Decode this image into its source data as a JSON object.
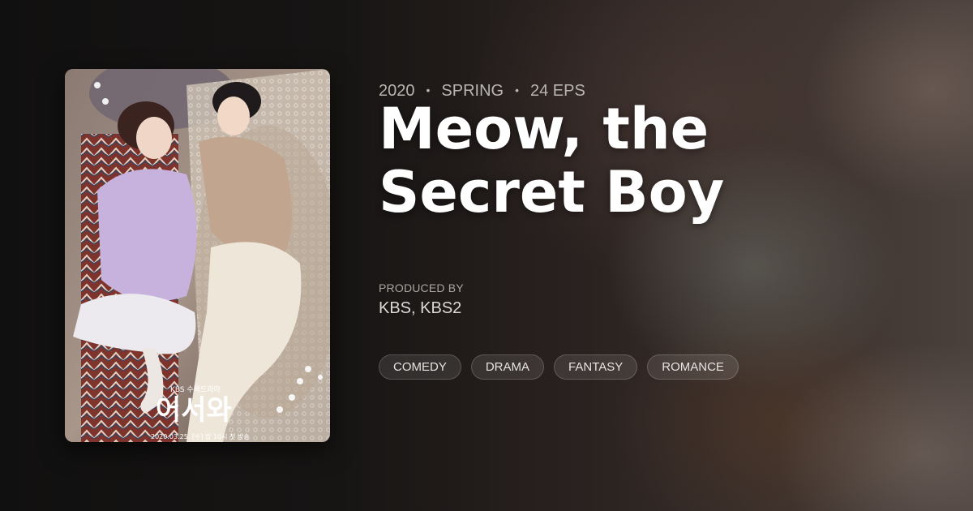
{
  "show": {
    "year": "2020",
    "season": "SPRING",
    "episodes": "24 EPS",
    "title": "Meow, the Secret Boy",
    "producer_label": "PRODUCED BY",
    "producers": "KBS, KBS2",
    "genres": [
      "COMEDY",
      "DRAMA",
      "FANTASY",
      "ROMANCE"
    ]
  },
  "poster": {
    "network_text": "KBS 수목드라마",
    "logo_text": "어서와",
    "date_text": "2020.03.25. [수] 밤 10시 첫 방송"
  },
  "separator": "•"
}
